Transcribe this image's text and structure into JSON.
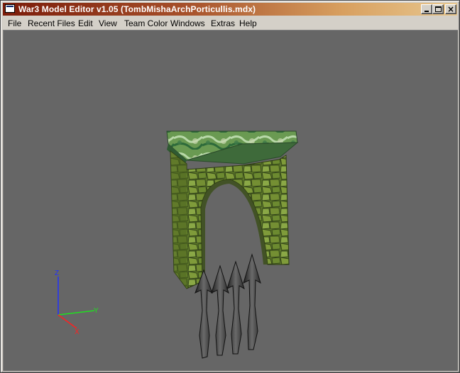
{
  "window": {
    "title": "War3 Model Editor v1.05 (TombMishaArchPorticullis.mdx)"
  },
  "menu": {
    "items": [
      "File",
      "Recent Files",
      "Edit",
      "View",
      "Team Color",
      "Windows",
      "Extras",
      "Help"
    ]
  },
  "viewport": {
    "background": "#666666",
    "axes": {
      "x": "X",
      "y": "Y",
      "z": "Z"
    },
    "axis_colors": {
      "x": "#ff2020",
      "y": "#20e020",
      "z": "#2030ff"
    }
  }
}
